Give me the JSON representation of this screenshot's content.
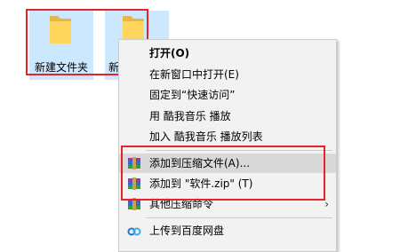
{
  "desktop": {
    "folder1_label": "新建文件夹",
    "folder2_label": "新建文件夹"
  },
  "menu": {
    "open": "打开(O)",
    "open_new_window": "在新窗口中打开(E)",
    "pin_quick_access": "固定到“快速访问”",
    "play_kugou": "用 酷我音乐 播放",
    "add_to_kugou_list": "加入 酷我音乐 播放列表",
    "add_to_archive": "添加到压缩文件(A)...",
    "add_to_zip": "添加到 \"软件.zip\" (T)",
    "other_compress": "其他压缩命令",
    "upload_baidu": "上传到百度网盘"
  },
  "colors": {
    "selection": "#cce8ff",
    "menu_bg": "#f2f2f2",
    "highlight": "#d9d9d9",
    "annotation_red": "#e4232b",
    "folder_yellow": "#ffd75e"
  },
  "icons": [
    "folder-icon",
    "winrar-icon",
    "chevron-right-icon",
    "baidu-netdisk-icon"
  ]
}
